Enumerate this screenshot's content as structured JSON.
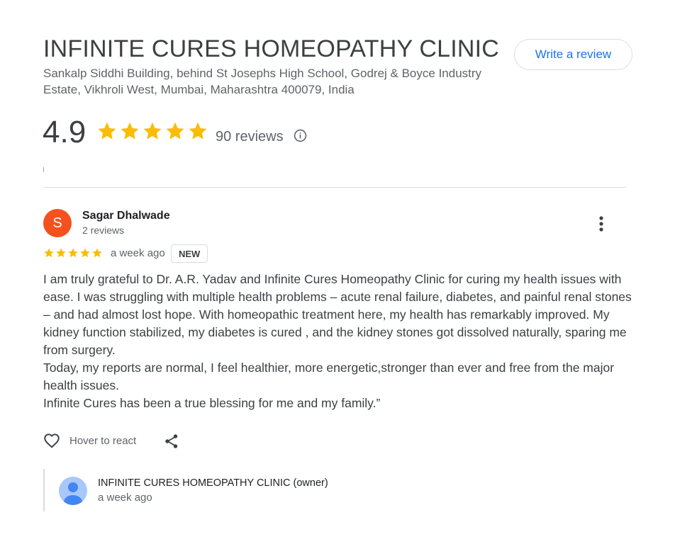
{
  "header": {
    "title": "INFINITE CURES HOMEOPATHY CLINIC",
    "address": "Sankalp Siddhi Building, behind St Josephs High School, Godrej & Boyce Industry Estate, Vikhroli West, Mumbai, Maharashtra 400079, India",
    "write_review_label": "Write a review"
  },
  "summary": {
    "rating": "4.9",
    "stars": 5,
    "review_count": "90 reviews",
    "star_color": "#fbbc04"
  },
  "review": {
    "avatar_letter": "S",
    "avatar_color": "#f4511e",
    "name": "Sagar Dhalwade",
    "reviews": "2 reviews",
    "stars": 5,
    "time": "a week ago",
    "badge": "NEW",
    "paragraphs": [
      "I am truly grateful to Dr. A.R. Yadav and Infinite Cures Homeopathy Clinic for curing my health issues with ease. I was struggling with multiple health problems – acute renal failure, diabetes, and painful renal stones – and had almost lost hope. With homeopathic treatment here, my health has remarkably improved. My kidney function stabilized, my diabetes is cured , and the kidney stones got dissolved naturally, sparing me from surgery.",
      "Today, my reports are normal, I feel healthier, more energetic,stronger than ever and free from the major health issues.",
      "Infinite Cures has been a true blessing for me and my family.”"
    ],
    "react_label": "Hover to react"
  },
  "owner_reply": {
    "name": "INFINITE CURES HOMEOPATHY CLINIC (owner)",
    "time": "a week ago"
  },
  "icons": {
    "star": "star-icon",
    "info": "info-icon",
    "more": "more-vert-icon",
    "heart": "heart-outline-icon",
    "share": "share-icon",
    "person": "person-avatar-icon"
  }
}
